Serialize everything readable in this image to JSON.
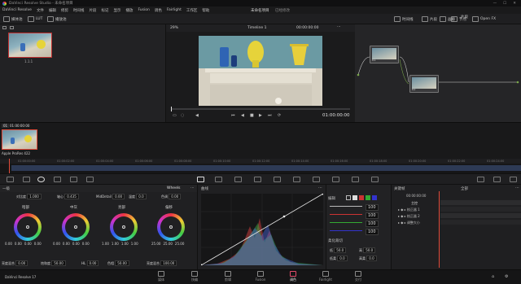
{
  "titlebar": {
    "title": "DaVinci Resolve Studio - 未命名项目"
  },
  "menu": {
    "items": [
      "DaVinci Resolve",
      "文件",
      "编辑",
      "修剪",
      "时间线",
      "片段",
      "标记",
      "显示",
      "播放",
      "Fusion",
      "调色",
      "Fairlight",
      "工作区",
      "帮助"
    ],
    "project_name": "未命名项目",
    "edited": "已经修改"
  },
  "toolbar": {
    "left": [
      "媒体池",
      "LUT",
      "播放池"
    ],
    "right": [
      "时间线",
      "片段",
      "画廊",
      "节点",
      "Open FX"
    ],
    "zoom": "29%",
    "timeline_name": "Timeline 1",
    "timecode_top": "00:00:00:00",
    "clip_label": "片段"
  },
  "mediapool": {
    "clip_number": "1.1.1"
  },
  "viewer": {
    "timecode": "01:00:00:00"
  },
  "nodes": {
    "node1": "01",
    "node2": "02"
  },
  "clip": {
    "timecode": "01:00:00:00",
    "codec": "Apple ProRes 422",
    "number": "01"
  },
  "timeline_ruler": [
    "01:00:00:00",
    "01:00:02:00",
    "01:00:04:00",
    "01:00:06:00",
    "01:00:08:00",
    "01:00:10:00",
    "01:00:12:00",
    "01:00:14:00",
    "01:00:16:00",
    "01:00:18:00",
    "01:00:20:00",
    "01:00:22:00",
    "01:00:24:00"
  ],
  "primaries": {
    "title": "一级",
    "mode": "Wheels",
    "params_top": [
      {
        "label": "对比度",
        "value": "1.000"
      },
      {
        "label": "轴心",
        "value": "0.435"
      },
      {
        "label": "MidDetail",
        "value": "0.00"
      },
      {
        "label": "温度",
        "value": "0.0"
      },
      {
        "label": "色调",
        "value": "0.00"
      }
    ],
    "wheels": [
      {
        "name": "暗部",
        "values": [
          "0.00",
          "0.00",
          "0.00",
          "0.00"
        ]
      },
      {
        "name": "中灰",
        "values": [
          "0.00",
          "0.00",
          "0.00",
          "0.00"
        ]
      },
      {
        "name": "亮部",
        "values": [
          "1.00",
          "1.00",
          "1.00",
          "1.00"
        ]
      },
      {
        "name": "偏移",
        "values": [
          "25.00",
          "25.00",
          "25.00"
        ]
      }
    ],
    "params_bottom": [
      {
        "label": "亮度混合",
        "value": "0.00"
      },
      {
        "label": "饱和度",
        "value": "50.00"
      },
      {
        "label": "HL",
        "value": "0.00"
      },
      {
        "label": "色相",
        "value": "50.00"
      },
      {
        "label": "亮度混合",
        "value": "100.00"
      }
    ]
  },
  "curves": {
    "title": "曲线"
  },
  "edit": {
    "title": "编辑",
    "channel_values": [
      "100",
      "100",
      "100",
      "100"
    ],
    "soft_clip_title": "柔化裁切",
    "soft_clip": [
      {
        "label": "低",
        "value": "50.0"
      },
      {
        "label": "高",
        "value": "50.0"
      },
      {
        "label": "低柔",
        "value": "0.0"
      },
      {
        "label": "高柔",
        "value": "0.0"
      }
    ]
  },
  "keyframes": {
    "title": "关键帧",
    "timecode": "00:00:00:00",
    "mode": "全部",
    "tracks": [
      "主控",
      "校正器 1",
      "校正器 2",
      "调整大小"
    ]
  },
  "bottom_nav": [
    "媒体",
    "快编",
    "剪辑",
    "Fusion",
    "调色",
    "Fairlight",
    "交付"
  ],
  "app": {
    "name": "DaVinci Resolve 17"
  },
  "colors": {
    "accent": "#e04b6a",
    "playhead": "#e04b3a"
  }
}
